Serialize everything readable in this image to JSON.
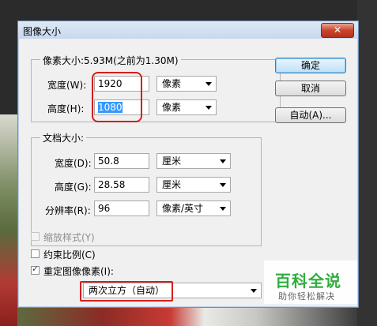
{
  "dialog": {
    "title": "图像大小",
    "close_icon": "close-icon"
  },
  "pixel_dimensions": {
    "title": "像素大小:5.93M(之前为1.30M)",
    "width": {
      "label": "宽度(W):",
      "value": "1920",
      "unit": "像素"
    },
    "height": {
      "label": "高度(H):",
      "value": "1080",
      "unit": "像素"
    }
  },
  "document_size": {
    "title": "文档大小:",
    "width": {
      "label": "宽度(D):",
      "value": "50.8",
      "unit": "厘米"
    },
    "height": {
      "label": "高度(G):",
      "value": "28.58",
      "unit": "厘米"
    },
    "resolution": {
      "label": "分辨率(R):",
      "value": "96",
      "unit": "像素/英寸"
    }
  },
  "options": {
    "scale_styles": {
      "label": "缩放样式(Y)",
      "checked": false,
      "enabled": false
    },
    "constrain_proportions": {
      "label": "约束比例(C)",
      "checked": false
    },
    "resample": {
      "label": "重定图像像素(I):",
      "checked": true
    },
    "resample_method": "两次立方（自动）"
  },
  "buttons": {
    "ok": "确定",
    "cancel": "取消",
    "auto": "自动(A)..."
  },
  "watermark": {
    "main": "百科全说",
    "sub": "助你轻松解决"
  },
  "colors": {
    "annotation_red": "#d21f1f",
    "selection_blue": "#3399ff",
    "watermark_green": "#2fae3d"
  }
}
